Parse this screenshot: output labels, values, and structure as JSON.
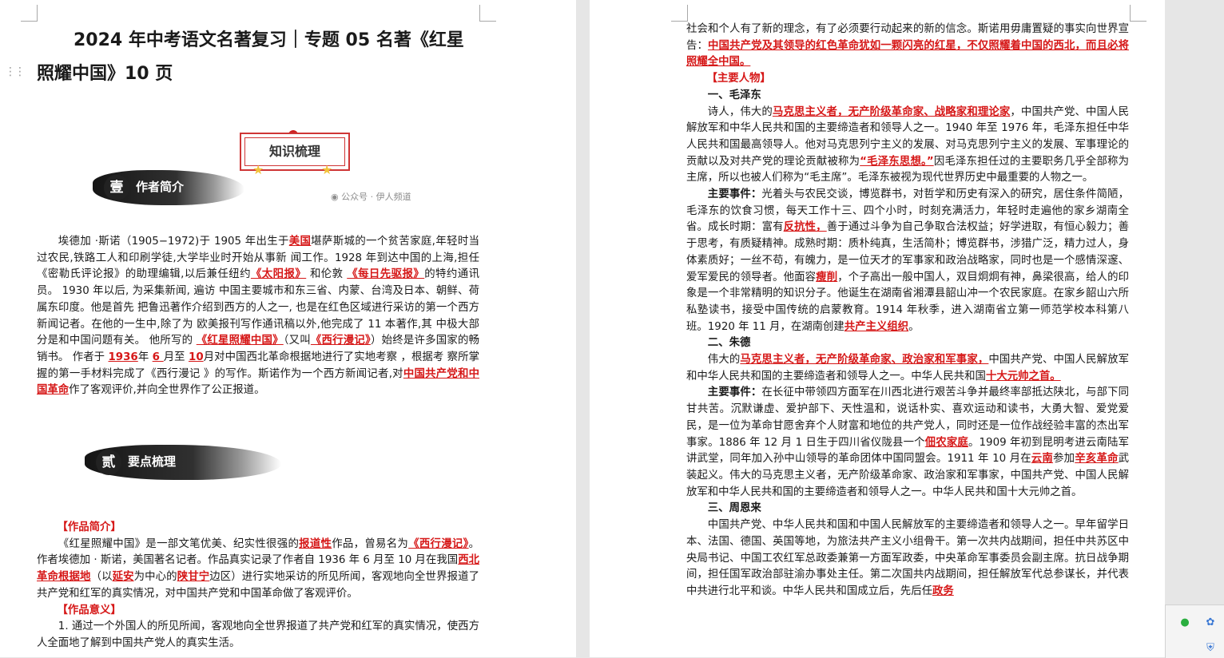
{
  "title": {
    "line1": "2024 年中考语文名著复习｜专题 05  名著《红星",
    "line2": "照耀中国》10 页"
  },
  "badge": "知识梳理",
  "watermark": "公众号 · 伊人频道",
  "sections": {
    "author": {
      "num": "壹",
      "label": "作者简介"
    },
    "points": {
      "num": "贰",
      "label": "要点梳理"
    }
  },
  "author_intro": {
    "p1": "埃德加 ·斯诺（1905−1972)于 1905 年出生于",
    "hl1": "美国",
    "p2": "堪萨斯城的一个贫苦家庭,年轻时当过农民,铁路工人和印刷学徒,大学毕业时开始从事新  闻工作。1928 年到达中国的上海,担任《密勒氏评论报》的助理编辑,以后兼任纽约",
    "hl2": "《太阳报》",
    "p3": "  和伦敦 ",
    "hl3": " 《每日先驱报》",
    "p4": "的特约通讯员。 1930 年以后, 为采集新闻, 遍访 中国主要城市和东三省、内蒙、台湾及日本、朝鲜、荷属东印度。他是首先  把鲁迅著作介绍到西方的人之一, 也是在红色区域进行采访的第一个西方新闻记者。在他的一生中,除了为  欧美报刊写作通讯稿以外,他完成了 11 本著作,其 中极大部分是和中国问题有关。 他所写的 ",
    "hl4": " 《红星照耀中国》",
    "p5": "（又叫",
    "hl5": "《西行漫记》",
    "p6": "）始终是许多国家的畅销书。 作者于 ",
    "hl6": "1936",
    "p7": "年 ",
    "hl7": " 6 ",
    "p8": "月至 ",
    "hl8": "10",
    "p9": "月对中国西北革命根据地进行了实地考察  ，根据考  察所掌握的第一手材料完成了《西行漫记 》的写作。斯诺作为一个西方新闻记者,对",
    "hl9": "中国共产党和中国革命",
    "p10": "作了客观评价,并向全世界作了公正报道。"
  },
  "work_intro": {
    "heading": "【作品简介】",
    "p1": "《红星照耀中国》是一部文笔优美、纪实性很强的",
    "hl1": "报道性",
    "p2": "作品，曾易名为",
    "hl2": "《西行漫记》",
    "p3": "。作者埃德加 · 斯诺，美国著名记者。作品真实记录了作者自 1936 年 6 月至 10 月在我国",
    "hl3": "西北革命根据地",
    "p4": "（以",
    "hl4": "延安",
    "p5": "为中心的",
    "hl5": "陕甘宁",
    "p6": "边区）进行实地采访的所见所闻，客观地向全世界报道了共产党和红军的真实情况，对中国共产党和中国革命做了客观评价。"
  },
  "significance": {
    "heading": "【作品意义】",
    "p1": "1. 通过一个外国人的所见所闻，客观地向全世界报道了共产党和红军的真实情况，使西方人全面地了解到中国共产党人的真实生活。"
  },
  "right_top": {
    "p1": "社会和个人有了新的理念，有了必须要行动起来的新的信念。斯诺用毋庸置疑的事实向世界宣告：",
    "hl1": "中国共产党及其领导的红色革命犹如一颗闪亮的红星，不仅照耀着中国的西北，而且必将照耀全中国。"
  },
  "characters": {
    "heading": "【主要人物】",
    "mao": {
      "title": "一、毛泽东",
      "p1": "诗人，伟大的",
      "hl1": "马克思主义者，无产阶级革命家、战略家和理论家",
      "p2": "，中国共产党、中国人民解放军和中华人民共和国的主要缔造者和领导人之一。1940 年至 1976 年，毛泽东担任中华人民共和国最高领导人。他对马克思列宁主义的发展、对马克思列宁主义的发展、军事理论的贡献以及对共产党的理论贡献被称为",
      "hl2": "“毛泽东思想。”",
      "p3": "因毛泽东担任过的主要职务几乎全部称为主席，所以也被人们称为“毛主席”。毛泽东被视为现代世界历史中最重要的人物之一。",
      "events_label": "主要事件：",
      "e1": "光着头与农民交谈，博览群书，对哲学和历史有深入的研究，居住条件简陋，毛泽东的饮食习惯，每天工作十三、四个小时，时刻充满活力，年轻时走遍他的家乡湖南全省。成长时期：富有",
      "ehl1": "反抗性，",
      "e2": "善于通过斗争为自己争取合法权益；好学进取，有恒心毅力；善于思考，有质疑精神。成熟时期：质朴纯真，生活简朴；博览群书，涉猎广泛，精力过人，身体素质好；一丝不苟，有魄力，是一位天才的军事家和政治战略家，同时也是一个感情深邃、爱军爱民的领导者。他面容",
      "ehl2": "瘦削",
      "e3": "，个子高出一般中国人，双目炯炯有神，鼻梁很高，给人的印象是一个非常精明的知识分子。他诞生在湖南省湘潭县韶山冲一个农民家庭。在家乡韶山六所私塾读书，接受中国传统的启蒙教育。1914 年秋季，进入湖南省立第一师范学校本科第八班。1920 年 11 月，在湖南创建",
      "ehl3": "共产主义组织",
      "e4": "。"
    },
    "zhu": {
      "title": "二、朱德",
      "p1": "伟大的",
      "hl1": "马克思主义者，无产阶级革命家、政治家和军事家，",
      "p2": "中国共产党、中国人民解放军和中华人民共和国的主要缔造者和领导人之一。中华人民共和国",
      "hl2": "十大元帅之首。",
      "events_label": "主要事件：",
      "e1": "在长征中带领四方面军在川西北进行艰苦斗争并最终率部抵达陕北，与部下同甘共苦。沉默谦虚、爱护部下、天性温和，说话朴实、喜欢运动和读书，大勇大智、爱党爱民，是一位为革命甘愿舍弃个人财富和地位的共产党人，同时还是一位作战经验丰富的杰出军事家。1886 年 12 月 1 日生于四川省仪陇县一个",
      "ehl1": "佃农家庭",
      "e2": "。1909 年初到昆明考进云南陆军讲武堂，同年加入孙中山领导的革命团体中国同盟会。1911 年 10 月在",
      "ehl2": "云南",
      "e3": "参加",
      "ehl3": "辛亥革命",
      "e4": "武装起义。伟大的马克思主义者，无产阶级革命家、政治家和军事家，中国共产党、中国人民解放军和中华人民共和国的主要缔造者和领导人之一。中华人民共和国十大元帅之首。"
    },
    "zhou": {
      "title": "三、周恩来",
      "p1": "中国共产党、中华人民共和国和中国人民解放军的主要缔造者和领导人之一。早年留学日本、法国、德国、英国等地，为旅法共产主义小组骨干。第一次共内战期间，担任中共苏区中央局书记、中国工农红军总政委兼第一方面军政委，中央革命军事委员会副主席。抗日战争期间，担任国军政治部驻渝办事处主任。第二次国共内战期间，担任解放军代总参谋长，并代表中共进行北平和谈。中华人民共和国成立后，先后任",
      "hl1": "政务"
    }
  }
}
